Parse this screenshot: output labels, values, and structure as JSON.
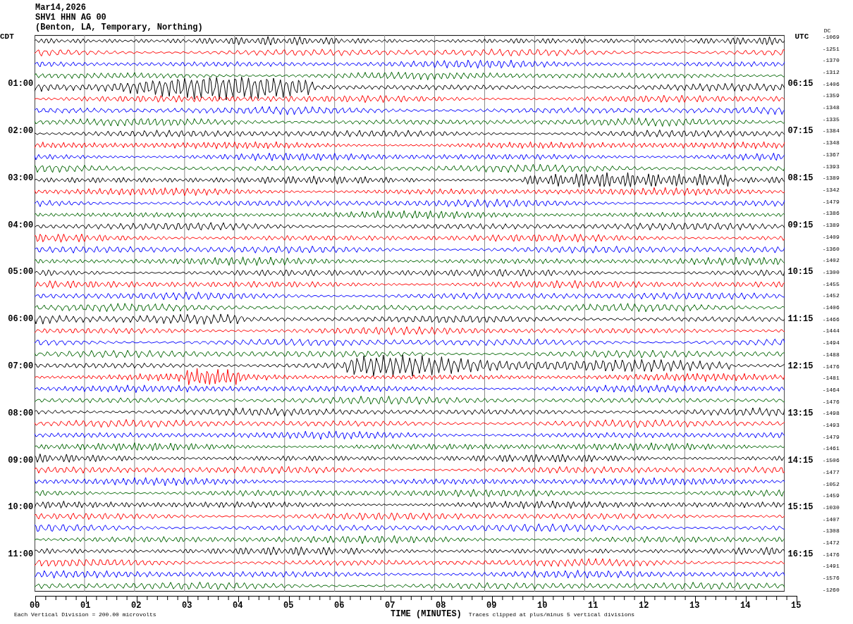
{
  "header": {
    "date": "Mar14,2026",
    "station": "SHV1 HHN AG 00",
    "location": "(Benton, LA, Temporary, Northing)"
  },
  "left_axis": {
    "zone": "CDT",
    "hours": [
      "01:00",
      "02:00",
      "03:00",
      "04:00",
      "05:00",
      "06:00",
      "07:00",
      "08:00",
      "09:00",
      "10:00",
      "11:00"
    ]
  },
  "right_axis": {
    "zone": "UTC",
    "hours": [
      "06:15",
      "07:15",
      "08:15",
      "09:15",
      "10:15",
      "11:15",
      "12:15",
      "13:15",
      "14:15",
      "15:15",
      "16:15"
    ]
  },
  "dc_offsets": {
    "heading": "DC",
    "values": [
      "-1069",
      "-1251",
      "-1370",
      "-1312",
      "-1406",
      "-1359",
      "-1348",
      "-1335",
      "-1384",
      "-1348",
      "-1367",
      "-1393",
      "-1389",
      "-1342",
      "-1479",
      "-1386",
      "-1389",
      "-1409",
      "-1360",
      "-1402",
      "-1300",
      "-1455",
      "-1452",
      "-1406",
      "-1466",
      "-1444",
      "-1494",
      "-1488",
      "-1476",
      "-1481",
      "-1464",
      "-1476",
      "-1498",
      "-1493",
      "-1479",
      "-1461",
      "-1506",
      "-1477",
      "-1052",
      "-1459",
      "-1030",
      "-1407",
      "-1308",
      "-1472",
      "-1476",
      "-1491",
      "-1576",
      "-1260"
    ]
  },
  "x_axis": {
    "ticks": [
      "00",
      "01",
      "02",
      "03",
      "04",
      "05",
      "06",
      "07",
      "08",
      "09",
      "10",
      "11",
      "12",
      "13",
      "14",
      "15"
    ],
    "title": "TIME (MINUTES)"
  },
  "footer": {
    "scale_note": "Each Vertical Division =  200.00 microvolts",
    "clip_note": "Traces clipped at plus/minus 5 vertical divisions"
  }
}
